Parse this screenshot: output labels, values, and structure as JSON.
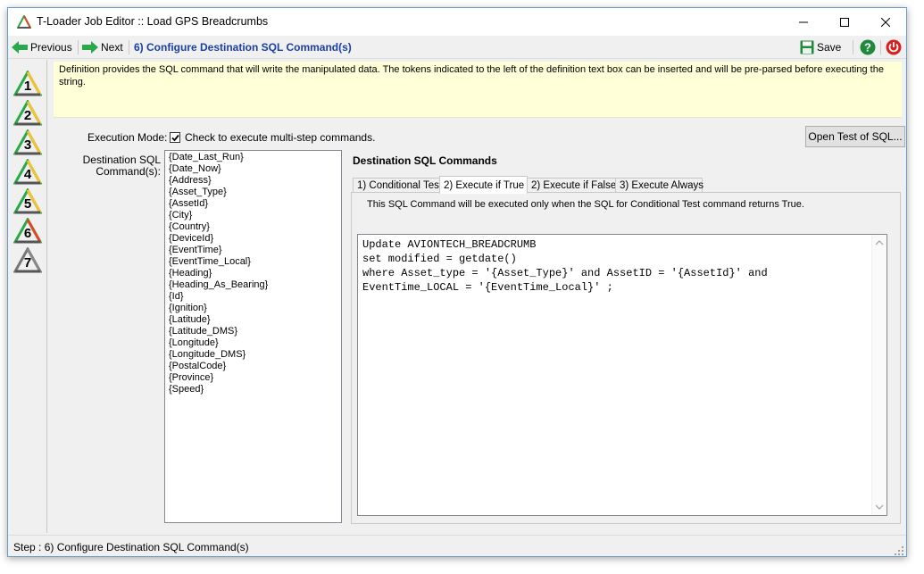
{
  "window": {
    "title": "T-Loader Job Editor :: Load GPS Breadcrumbs"
  },
  "toolbar": {
    "previous_label": "Previous",
    "next_label": "Next",
    "step_title": "6) Configure Destination SQL Command(s)",
    "save_label": "Save"
  },
  "steps": [
    {
      "number": "1",
      "color": "#f2c230"
    },
    {
      "number": "2",
      "color": "#f2c230"
    },
    {
      "number": "3",
      "color": "#f2c230"
    },
    {
      "number": "4",
      "color": "#f2c230"
    },
    {
      "number": "5",
      "color": "#f2c230"
    },
    {
      "number": "6",
      "color": "#d94a1e"
    },
    {
      "number": "7",
      "color": "#888888"
    }
  ],
  "info": {
    "text": "Definition provides the SQL command that will write the manipulated data. The tokens indicated to the left of the definition text box can be inserted and will be pre-parsed before executing the string."
  },
  "execution": {
    "label": "Execution Mode:",
    "checkbox_label": "Check to execute multi-step commands.",
    "checked": true,
    "open_test_label": "Open Test of SQL..."
  },
  "destination": {
    "label_line1": "Destination SQL",
    "label_line2": "Command(s):",
    "heading": "Destination SQL Commands",
    "tokens": [
      "{Date_Last_Run}",
      "{Date_Now}",
      "{Address}",
      "{Asset_Type}",
      "{AssetId}",
      "{City}",
      "{Country}",
      "{DeviceId}",
      "{EventTime}",
      "{EventTime_Local}",
      "{Heading}",
      "{Heading_As_Bearing}",
      "{Id}",
      "{Ignition}",
      "{Latitude}",
      "{Latitude_DMS}",
      "{Longitude}",
      "{Longitude_DMS}",
      "{PostalCode}",
      "{Province}",
      "{Speed}"
    ]
  },
  "tabs": [
    {
      "label": "1) Conditional Test"
    },
    {
      "label": "2) Execute if True"
    },
    {
      "label": "2) Execute if False"
    },
    {
      "label": "3) Execute Always"
    }
  ],
  "active_tab": {
    "description": "This SQL Command will be executed only when the SQL for Conditional Test command returns True.",
    "sql": "Update AVIONTECH_BREADCRUMB\nset modified = getdate()\nwhere Asset_type = '{Asset_Type}' and AssetID = '{AssetId}' and\nEventTime_LOCAL = '{EventTime_Local}' ;"
  },
  "status": {
    "text": "Step : 6) Configure Destination SQL Command(s)"
  },
  "colors": {
    "accent": "#1a3fa6",
    "info_background": "#ffffd8",
    "help": "#1f8a3a",
    "power": "#d92020",
    "save": "#1f8a3a",
    "nav_arrow": "#2aa84a"
  }
}
